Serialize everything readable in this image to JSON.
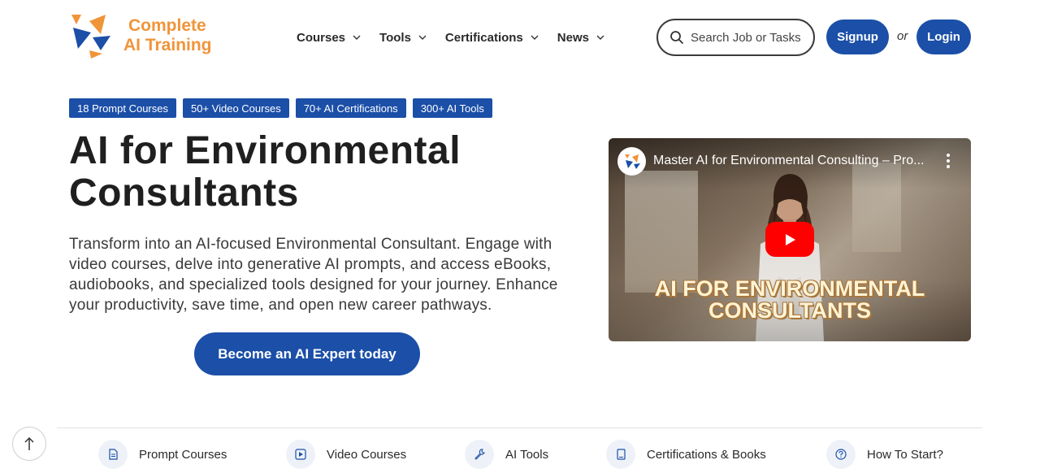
{
  "header": {
    "logo_line1": "Complete",
    "logo_line2": "AI Training",
    "nav": [
      {
        "label": "Courses"
      },
      {
        "label": "Tools"
      },
      {
        "label": "Certifications"
      },
      {
        "label": "News"
      }
    ],
    "search_placeholder": "Search Job or Tasks",
    "signup_label": "Signup",
    "or_text": "or",
    "login_label": "Login"
  },
  "badges": [
    "18 Prompt Courses",
    "50+ Video Courses",
    "70+ AI Certifications",
    "300+ AI Tools"
  ],
  "hero": {
    "title": "AI for Environmental Consultants",
    "description": "Transform into an AI-focused Environmental Consultant. Engage with video courses, delve into generative AI prompts, and access eBooks, audiobooks, and specialized tools designed for your journey. Enhance your productivity, save time, and open new career pathways.",
    "cta_label": "Become an AI Expert today"
  },
  "video": {
    "title": "Master AI for Environmental Consulting – Pro...",
    "overlay_line1": "AI FOR ENVIRONMENTAL",
    "overlay_line2": "CONSULTANTS"
  },
  "bottom_nav": [
    {
      "label": "Prompt Courses",
      "icon": "document-icon"
    },
    {
      "label": "Video Courses",
      "icon": "play-square-icon"
    },
    {
      "label": "AI Tools",
      "icon": "wrench-icon"
    },
    {
      "label": "Certifications & Books",
      "icon": "book-icon"
    },
    {
      "label": "How To Start?",
      "icon": "question-icon"
    }
  ],
  "colors": {
    "brand_blue": "#1b4fa8",
    "logo_orange": "#f0943a",
    "youtube_red": "#ff0000"
  }
}
